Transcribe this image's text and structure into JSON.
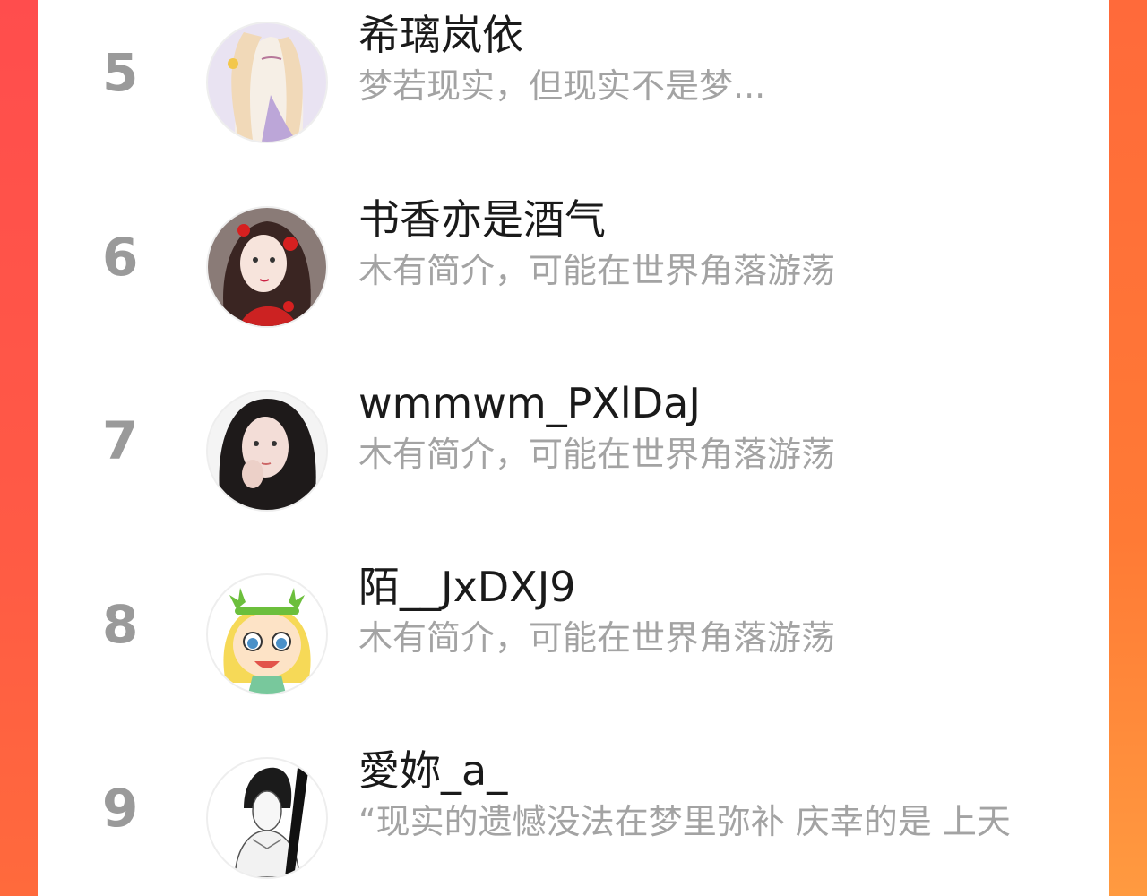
{
  "leaderboard": {
    "items": [
      {
        "rank": "5",
        "name": "希璃岚依",
        "bio": "梦若现实，但现实不是梦..."
      },
      {
        "rank": "6",
        "name": "书香亦是酒气",
        "bio": "木有简介，可能在世界角落游荡"
      },
      {
        "rank": "7",
        "name": "wmmwm_PXlDaJ",
        "bio": "木有简介，可能在世界角落游荡"
      },
      {
        "rank": "8",
        "name": "陌__JxDXJ9",
        "bio": "木有简介，可能在世界角落游荡"
      },
      {
        "rank": "9",
        "name": "愛妳_a_",
        "bio": "“现实的遗憾没法在梦里弥补 庆幸的是 上天"
      }
    ]
  },
  "colors": {
    "accent_left": "#ff4d4d",
    "accent_right": "#ff8a3a",
    "rank_gray": "#9a9a9a",
    "bio_gray": "#a3a3a3",
    "name_dark": "#1a1a1a"
  }
}
